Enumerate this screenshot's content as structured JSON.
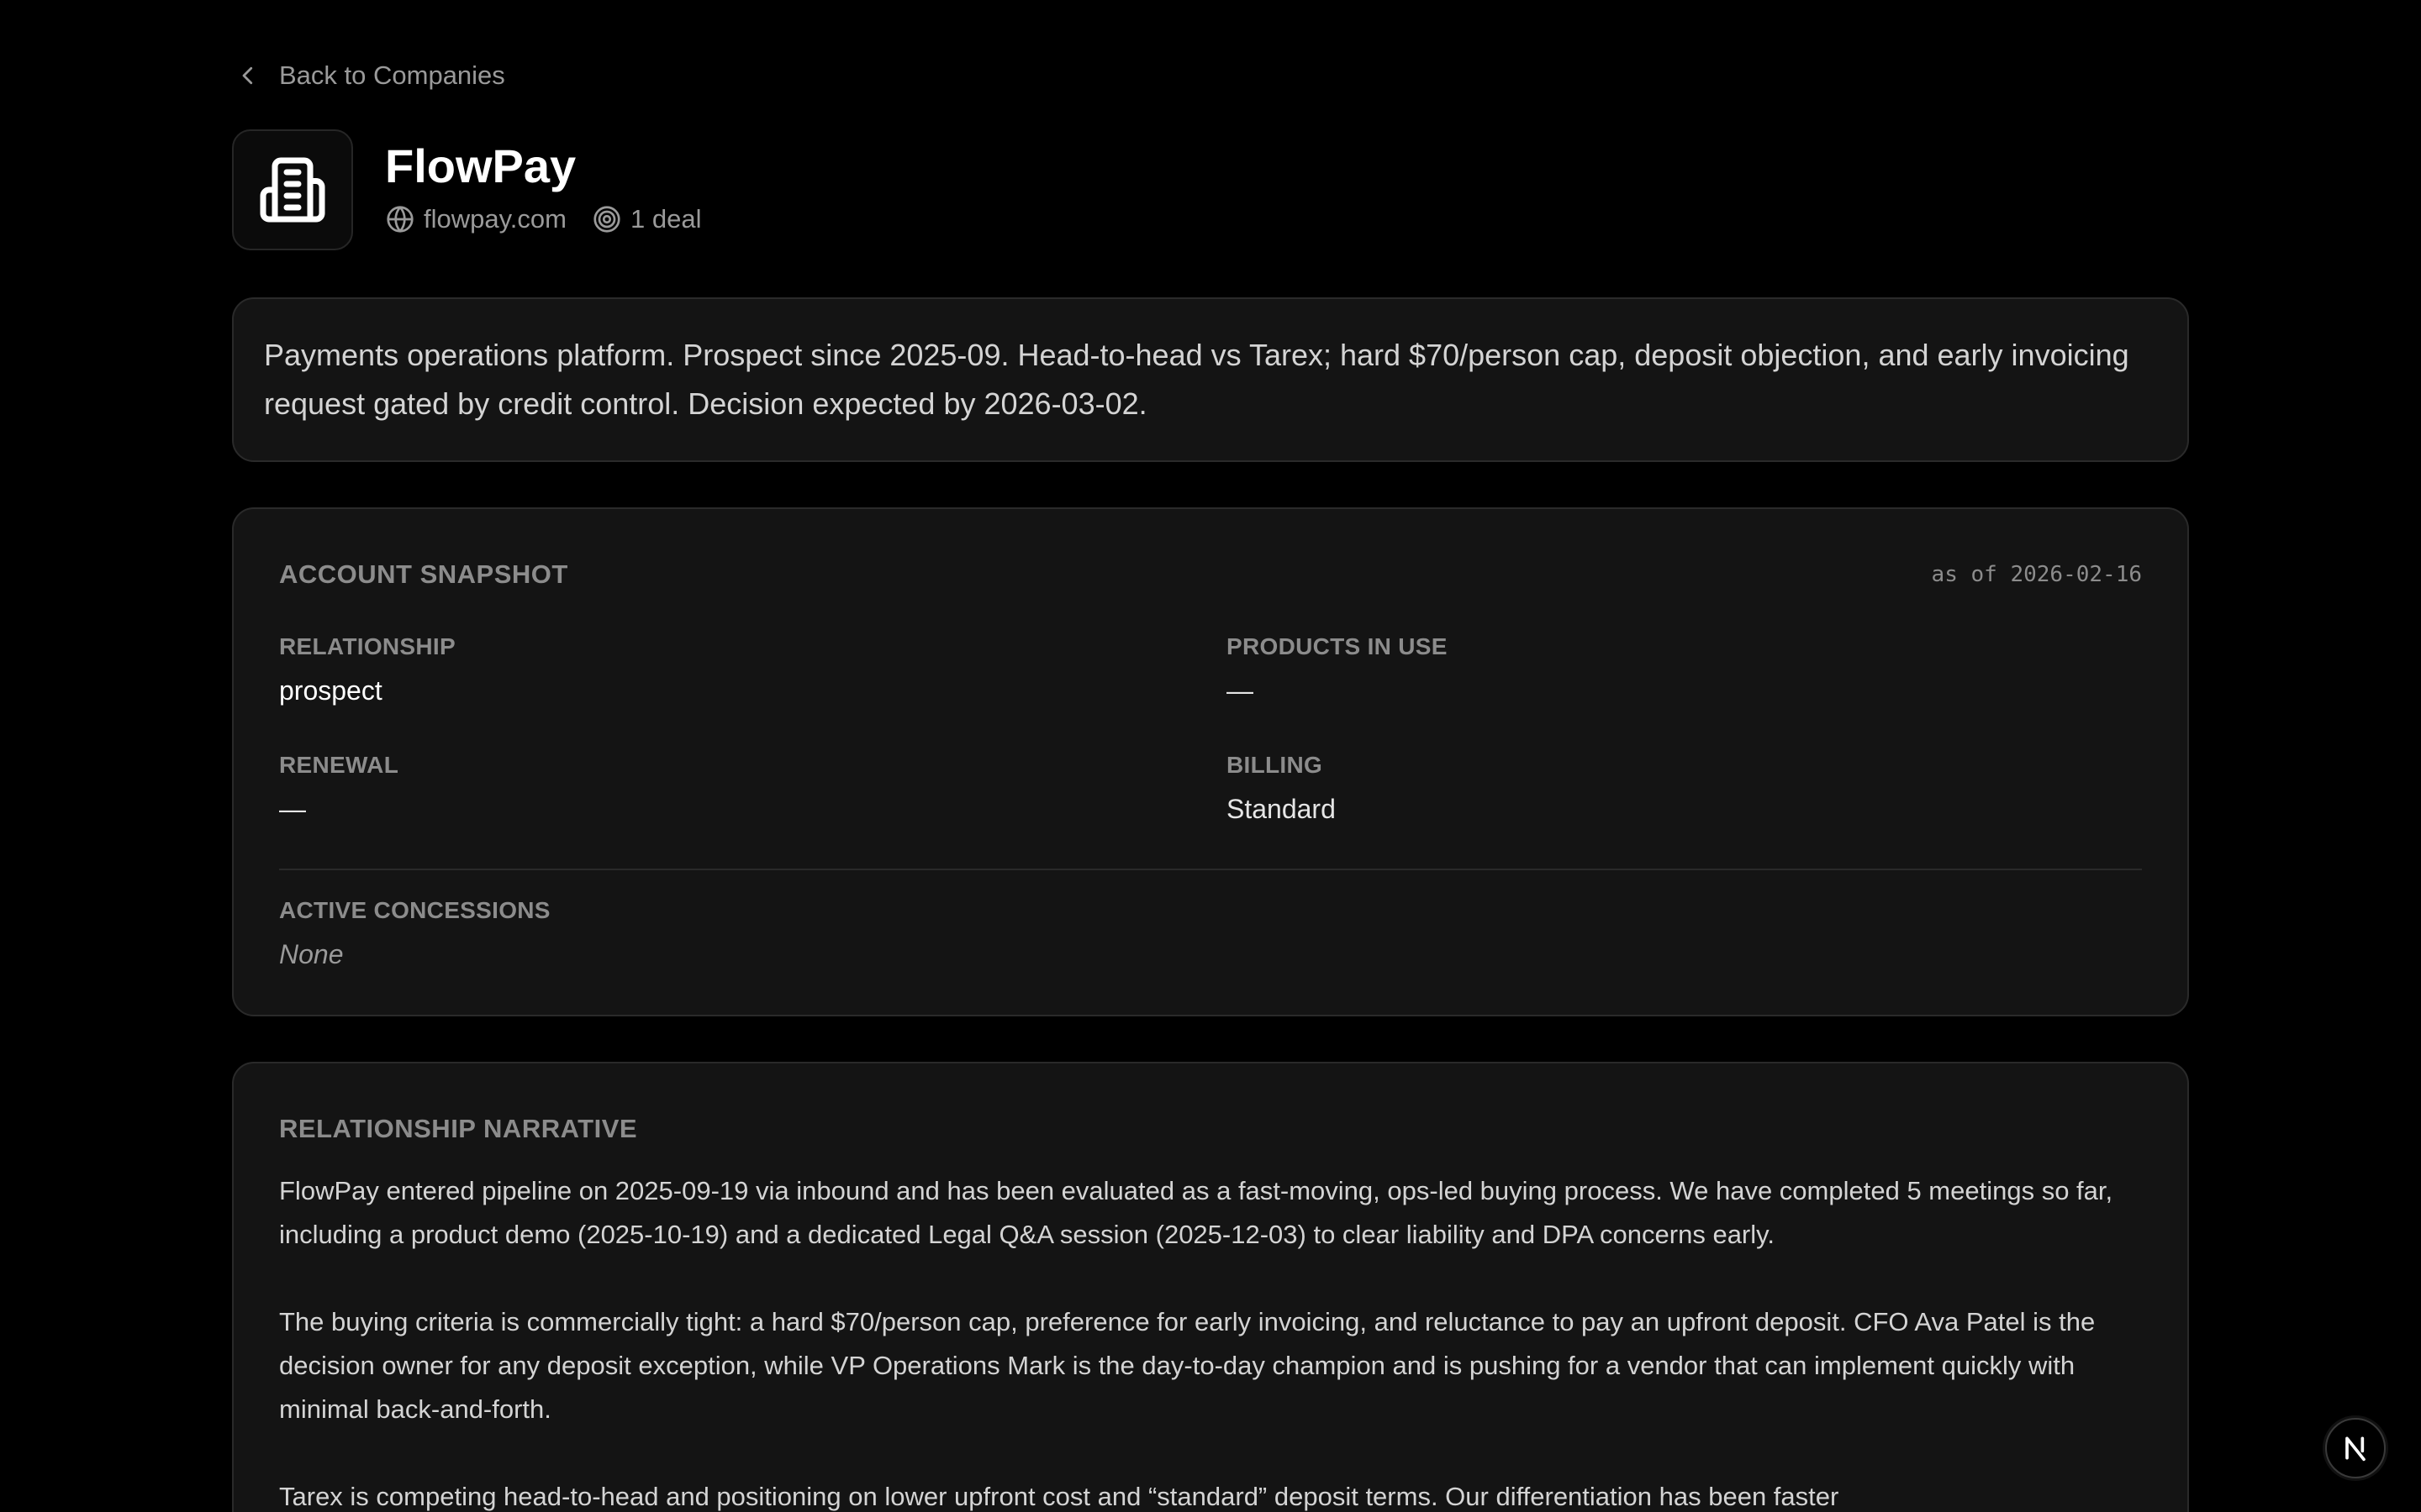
{
  "nav": {
    "back_label": "Back to Companies"
  },
  "company": {
    "name": "FlowPay",
    "domain": "flowpay.com",
    "deals": "1 deal",
    "summary": "Payments operations platform. Prospect since 2025-09. Head-to-head vs Tarex; hard $70/person cap, deposit objection, and early invoicing request gated by credit control. Decision expected by 2026-03-02."
  },
  "snapshot": {
    "title": "ACCOUNT SNAPSHOT",
    "as_of": "as of 2026-02-16",
    "relationship_label": "RELATIONSHIP",
    "relationship_value": "prospect",
    "products_label": "PRODUCTS IN USE",
    "products_value": "—",
    "renewal_label": "RENEWAL",
    "renewal_value": "—",
    "billing_label": "BILLING",
    "billing_value": "Standard",
    "concessions_label": "ACTIVE CONCESSIONS",
    "concessions_value": "None"
  },
  "narrative": {
    "title": "RELATIONSHIP NARRATIVE",
    "paragraphs": [
      "FlowPay entered pipeline on 2025-09-19 via inbound and has been evaluated as a fast-moving, ops-led buying process. We have completed 5 meetings so far, including a product demo (2025-10-19) and a dedicated Legal Q&A session (2025-12-03) to clear liability and DPA concerns early.",
      "The buying criteria is commercially tight: a hard $70/person cap, preference for early invoicing, and reluctance to pay an upfront deposit. CFO Ava Patel is the decision owner for any deposit exception, while VP Operations Mark is the day-to-day champion and is pushing for a vendor that can implement quickly with minimal back-and-forth.",
      "Tarex is competing head-to-head and positioning on lower upfront cost and “standard” deposit terms. Our differentiation has been faster"
    ]
  },
  "icons": {
    "back": "chevron-left-icon",
    "logo": "building-icon",
    "domain": "globe-icon",
    "deals": "target-icon",
    "devtools": "next-n-icon"
  }
}
